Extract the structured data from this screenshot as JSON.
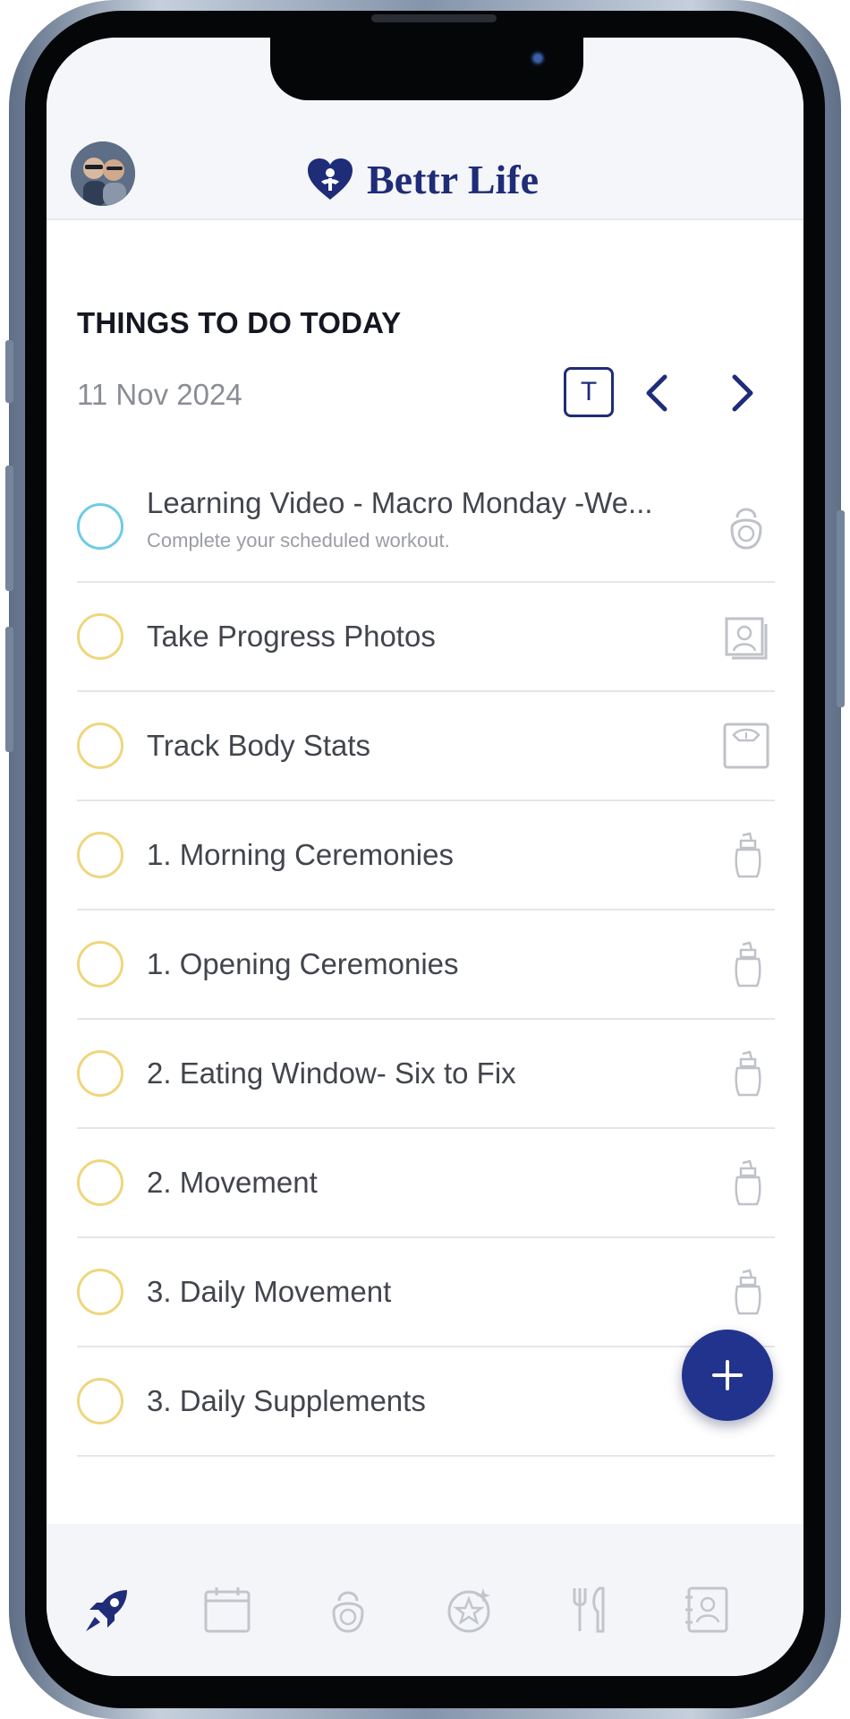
{
  "app": {
    "brand_name": "Bettr Life",
    "brand_color": "#1f2c78",
    "accent_blue": "#22338d"
  },
  "header": {
    "avatar_icon": "user-avatar-photo",
    "logo_icon": "heart-logo-icon"
  },
  "section": {
    "title": "THINGS TO DO TODAY",
    "date": "11 Nov 2024",
    "today_button_label": "T",
    "prev_icon": "chevron-left-icon",
    "next_icon": "chevron-right-icon"
  },
  "tasks": [
    {
      "title": "Learning Video - Macro Monday -We...",
      "subtitle": "Complete your scheduled workout.",
      "circle_color": "#6fcbe6",
      "icon": "kettlebell-icon"
    },
    {
      "title": "Take Progress Photos",
      "circle_color": "#efd67c",
      "icon": "photos-icon"
    },
    {
      "title": "Track Body Stats",
      "circle_color": "#efd67c",
      "icon": "scale-icon"
    },
    {
      "title": "1. Morning Ceremonies",
      "circle_color": "#efd67c",
      "icon": "jar-icon"
    },
    {
      "title": "1. Opening Ceremonies",
      "circle_color": "#efd67c",
      "icon": "jar-icon"
    },
    {
      "title": "2. Eating Window- Six to Fix",
      "circle_color": "#efd67c",
      "icon": "jar-icon"
    },
    {
      "title": "2. Movement",
      "circle_color": "#efd67c",
      "icon": "jar-icon"
    },
    {
      "title": "3. Daily Movement",
      "circle_color": "#efd67c",
      "icon": "jar-icon"
    },
    {
      "title": "3. Daily Supplements",
      "circle_color": "#efd67c",
      "icon": "none"
    }
  ],
  "fab": {
    "icon": "plus-icon"
  },
  "bottom_nav": [
    {
      "icon": "rocket-icon",
      "active": true
    },
    {
      "icon": "calendar-icon",
      "active": false
    },
    {
      "icon": "kettlebell-icon",
      "active": false
    },
    {
      "icon": "star-badge-icon",
      "active": false
    },
    {
      "icon": "fork-knife-icon",
      "active": false
    },
    {
      "icon": "contact-book-icon",
      "active": false
    }
  ]
}
